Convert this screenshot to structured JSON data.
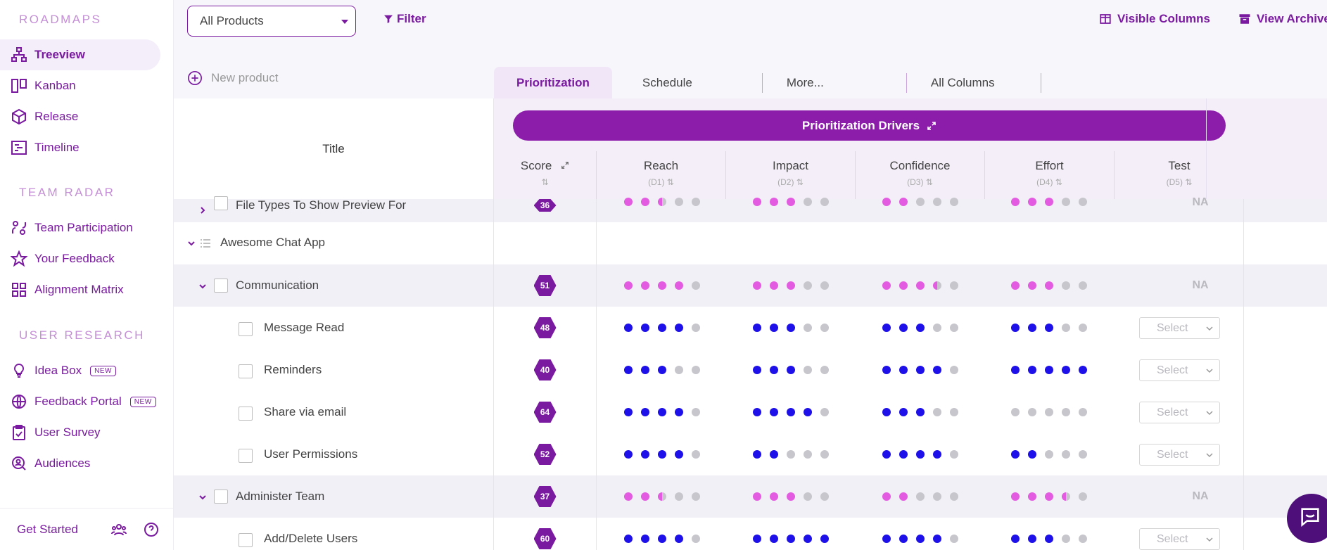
{
  "sidebar": {
    "sections": [
      {
        "title": "ROADMAPS"
      },
      {
        "title": "TEAM RADAR"
      },
      {
        "title": "USER RESEARCH"
      }
    ],
    "items": [
      {
        "label": "Treeview",
        "icon": "treeview-icon"
      },
      {
        "label": "Kanban",
        "icon": "kanban-icon"
      },
      {
        "label": "Release",
        "icon": "release-icon"
      },
      {
        "label": "Timeline",
        "icon": "timeline-icon"
      },
      {
        "label": "Team Participation",
        "icon": "team-participation-icon"
      },
      {
        "label": "Your Feedback",
        "icon": "star-icon"
      },
      {
        "label": "Alignment Matrix",
        "icon": "grid-icon"
      },
      {
        "label": "Idea Box",
        "icon": "lightbulb-icon",
        "badge": "NEW"
      },
      {
        "label": "Feedback Portal",
        "icon": "globe-icon",
        "badge": "NEW"
      },
      {
        "label": "User Survey",
        "icon": "clipboard-icon"
      },
      {
        "label": "Audiences",
        "icon": "audience-search-icon"
      }
    ],
    "footer": {
      "label": "Get Started"
    }
  },
  "toolbar": {
    "product_select": "All Products",
    "filter": "Filter",
    "visible_columns": "Visible Columns",
    "view_archive": "View Archive",
    "new_product": "New product"
  },
  "tabs": [
    "Prioritization",
    "Schedule",
    "More...",
    "All Columns"
  ],
  "table": {
    "title_header": "Title",
    "drivers_bar": "Prioritization Drivers",
    "columns": [
      {
        "name": "Score",
        "sub": ""
      },
      {
        "name": "Reach",
        "sub": "(D1)"
      },
      {
        "name": "Impact",
        "sub": "(D2)"
      },
      {
        "name": "Confidence",
        "sub": "(D3)"
      },
      {
        "name": "Effort",
        "sub": "(D4)"
      },
      {
        "name": "Test",
        "sub": "(D5)"
      }
    ],
    "rows": [
      {
        "title": "File Types To Show Preview For",
        "score": "36",
        "test": "NA"
      },
      {
        "title": "Awesome Chat App"
      },
      {
        "title": "Communication",
        "score": "51",
        "test": "NA"
      },
      {
        "title": "Message Read",
        "score": "48",
        "test": "Select"
      },
      {
        "title": "Reminders",
        "score": "40",
        "test": "Select"
      },
      {
        "title": "Share via email",
        "score": "64",
        "test": "Select"
      },
      {
        "title": "User Permissions",
        "score": "52",
        "test": "Select"
      },
      {
        "title": "Administer Team",
        "score": "37",
        "test": "NA"
      },
      {
        "title": "Add/Delete Users",
        "score": "60",
        "test": "Select"
      }
    ]
  },
  "colors": {
    "accent": "#7a1aa0",
    "drivers_bar": "#8c1caa",
    "dot_blue": "#1d10e8",
    "dot_pink": "#e25be0",
    "dot_gray": "#c6c6cc"
  }
}
